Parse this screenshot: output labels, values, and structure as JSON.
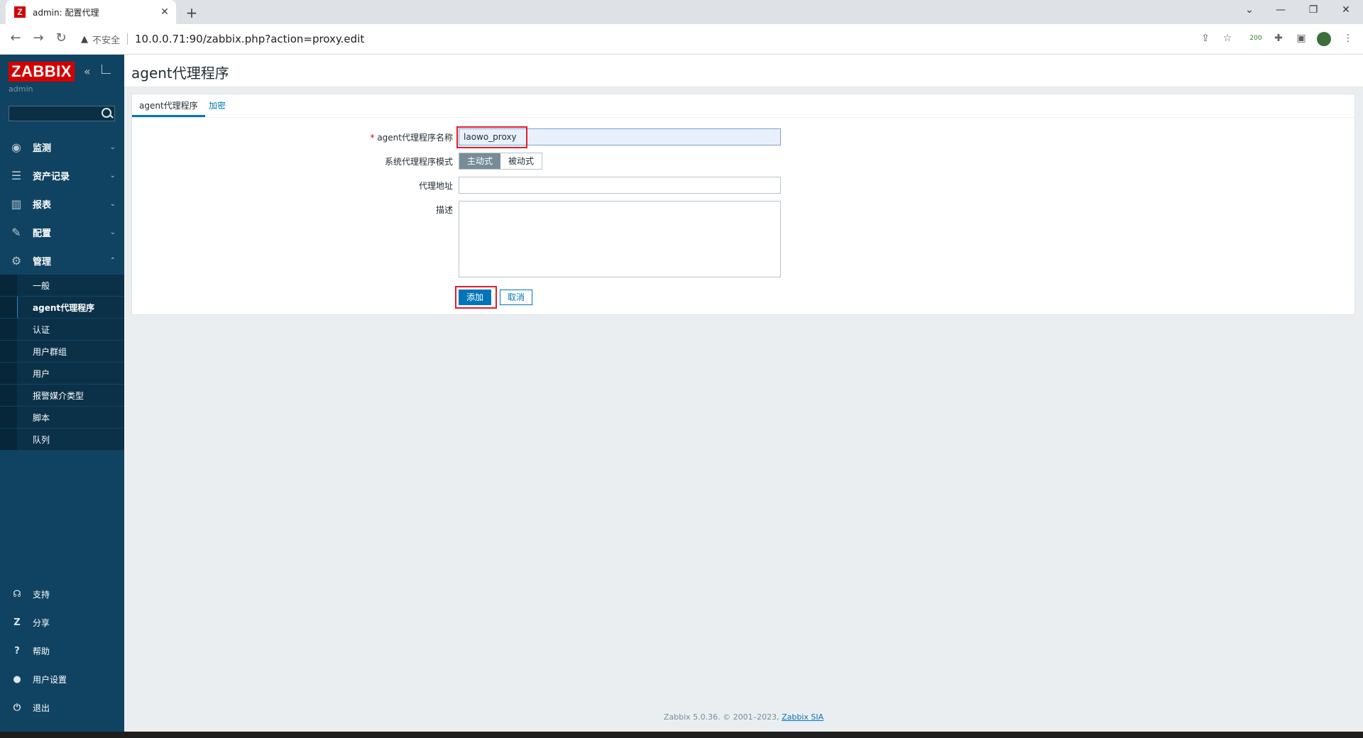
{
  "browser": {
    "tab_title": "admin: 配置代理",
    "favicon": "Z",
    "new_tab": "+",
    "security_label": "不安全",
    "url": "10.0.0.71:90/zabbix.php?action=proxy.edit",
    "extension_badge": "200"
  },
  "sidebar": {
    "logo": "ZABBIX",
    "user": "admin",
    "menu": [
      {
        "label": "监测",
        "icon": "eye-icon"
      },
      {
        "label": "资产记录",
        "icon": "list-icon"
      },
      {
        "label": "报表",
        "icon": "chart-icon"
      },
      {
        "label": "配置",
        "icon": "wrench-icon"
      },
      {
        "label": "管理",
        "icon": "gear-icon"
      }
    ],
    "submenu": [
      "一般",
      "agent代理程序",
      "认证",
      "用户群组",
      "用户",
      "报警媒介类型",
      "脚本",
      "队列"
    ],
    "bottom": [
      {
        "label": "支持",
        "icon": "headset-icon"
      },
      {
        "label": "分享",
        "icon": "share-icon"
      },
      {
        "label": "帮助",
        "icon": "help-icon"
      },
      {
        "label": "用户设置",
        "icon": "user-icon"
      },
      {
        "label": "退出",
        "icon": "power-icon"
      }
    ]
  },
  "page": {
    "title": "agent代理程序",
    "tabs": [
      "agent代理程序",
      "加密"
    ],
    "form": {
      "name_label": "agent代理程序名称",
      "name_value": "laowo_proxy",
      "mode_label": "系统代理程序模式",
      "mode_active": "主动式",
      "mode_passive": "被动式",
      "address_label": "代理地址",
      "address_value": "",
      "description_label": "描述",
      "description_value": "",
      "add_button": "添加",
      "cancel_button": "取消"
    }
  },
  "footer": {
    "text": "Zabbix 5.0.36. © 2001–2023, ",
    "link": "Zabbix SIA"
  },
  "colors": {
    "sidebar": "#0f4361",
    "accent": "#0275b8",
    "highlight": "#e11d2d",
    "logo": "#d40000"
  }
}
